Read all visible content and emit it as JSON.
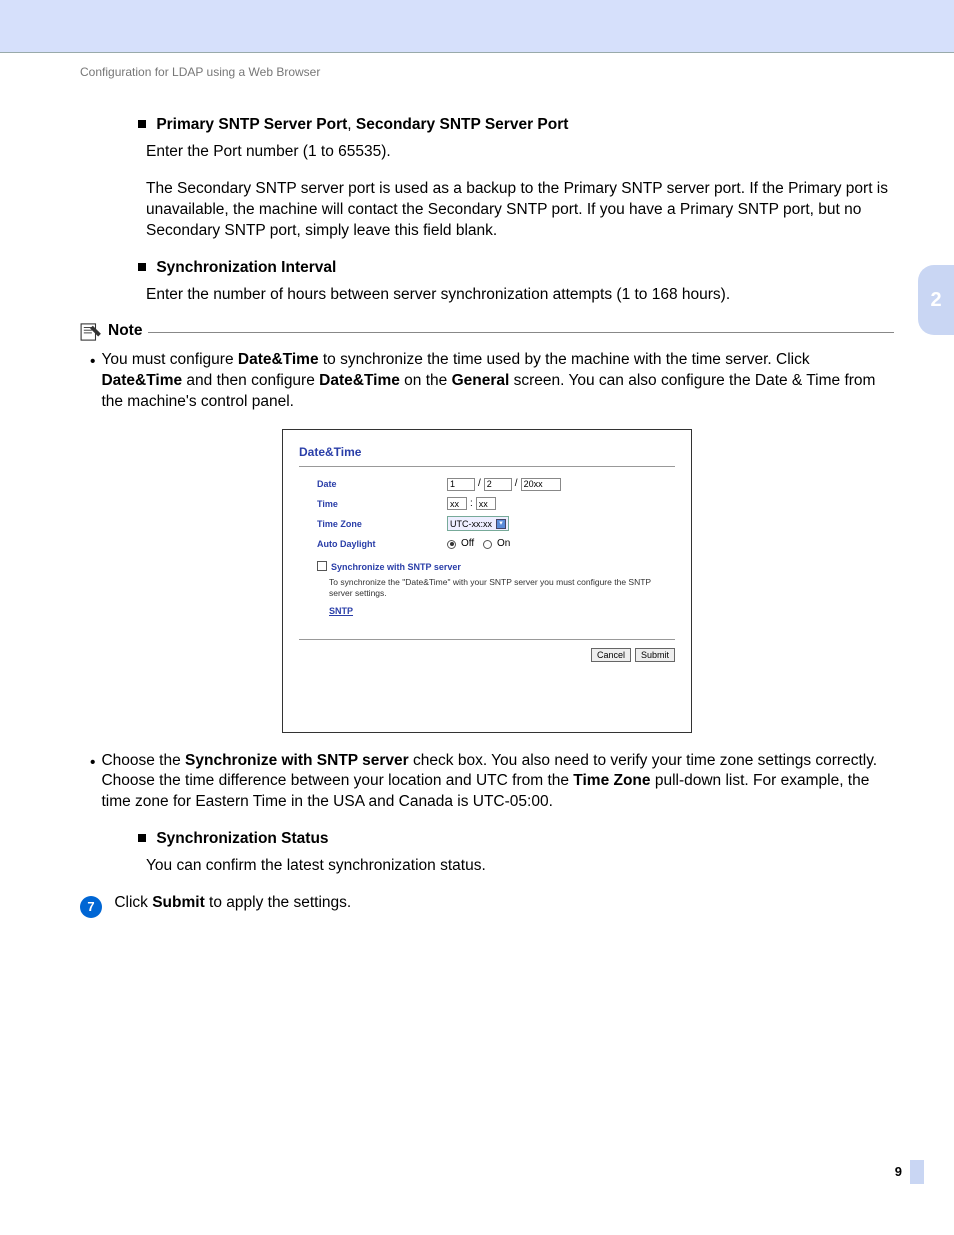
{
  "breadcrumb": "Configuration for LDAP using a Web Browser",
  "side_tab": "2",
  "page_number": "9",
  "s1": {
    "title_a": "Primary SNTP Server Port",
    "title_sep": ", ",
    "title_b": "Secondary SNTP Server Port",
    "p1": "Enter the Port number (1 to 65535).",
    "p2": "The Secondary SNTP server port is used as a backup to the Primary SNTP server port. If the Primary port is unavailable, the machine will contact the Secondary SNTP port. If you have a Primary SNTP port, but no Secondary SNTP port, simply leave this field blank."
  },
  "s2": {
    "title": "Synchronization Interval",
    "p1": "Enter the number of hours between server synchronization attempts (1 to 168 hours)."
  },
  "note": {
    "label": "Note",
    "b1_pre": "You must configure ",
    "b1_bold1": "Date&Time",
    "b1_mid1": " to synchronize the time used by the machine with the  time server. Click ",
    "b1_bold2": "Date&Time",
    "b1_mid2": " and then configure ",
    "b1_bold3": "Date&Time",
    "b1_mid3": " on the ",
    "b1_bold4": "General",
    "b1_post": " screen. You can also configure the Date & Time from the machine's control panel."
  },
  "ss": {
    "title": "Date&Time",
    "date_label": "Date",
    "date_v1": "1",
    "date_sep": "/",
    "date_v2": "2",
    "date_v3": "20xx",
    "time_label": "Time",
    "time_v1": "xx",
    "time_sep": ":",
    "time_v2": "xx",
    "tz_label": "Time Zone",
    "tz_value": "UTC-xx:xx",
    "ad_label": "Auto Daylight",
    "ad_off": "Off",
    "ad_on": "On",
    "sync_label": "Synchronize with SNTP server",
    "sync_note": "To synchronize the \"Date&Time\" with your SNTP server you must configure the SNTP server settings.",
    "sntp_link": "SNTP",
    "cancel": "Cancel",
    "submit": "Submit"
  },
  "b2": {
    "pre": "Choose the ",
    "bold1": "Synchronize with SNTP server",
    "mid1": " check box. You also need to verify your time zone settings correctly. Choose the time difference between your location and UTC from the ",
    "bold2": "Time Zone",
    "post": " pull-down list. For example, the time zone for Eastern Time in the USA and Canada is UTC-05:00."
  },
  "s3": {
    "title": "Synchronization Status",
    "p1": "You can confirm the latest synchronization status."
  },
  "step7": {
    "num": "7",
    "pre": "Click ",
    "bold": "Submit",
    "post": " to apply the settings."
  }
}
